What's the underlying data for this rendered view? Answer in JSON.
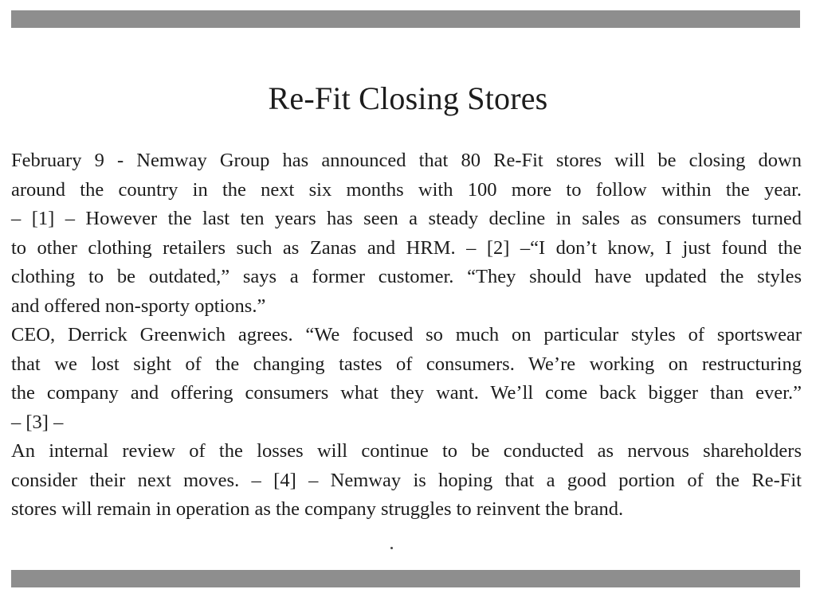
{
  "article": {
    "title": "Re-Fit Closing Stores",
    "lines": [
      "February 9 - Nemway Group has announced that 80 Re-Fit stores will be closing down",
      "around the country in the next six months with 100 more to follow within the year.",
      "– [1] – However the last ten years has seen a steady decline in sales as consumers turned",
      "to other clothing retailers such as Zanas and HRM. – [2] –“I don’t know, I just found the",
      "clothing to be outdated,” says a former customer. “They should have updated the styles",
      "and offered non-sporty options.”",
      "CEO, Derrick Greenwich agrees. “We focused so much on particular styles of sportswear",
      "that we lost sight of the changing tastes of consumers. We’re working on restructuring",
      "the company and offering consumers what they want. We’ll come back bigger than ever.”",
      "– [3] –",
      "An internal review of the losses will continue to be conducted as nervous shareholders",
      "consider their next moves. – [4] – Nemway is hoping that a good portion of the Re-Fit",
      "stores will remain in operation as the company struggles to reinvent the brand."
    ]
  }
}
